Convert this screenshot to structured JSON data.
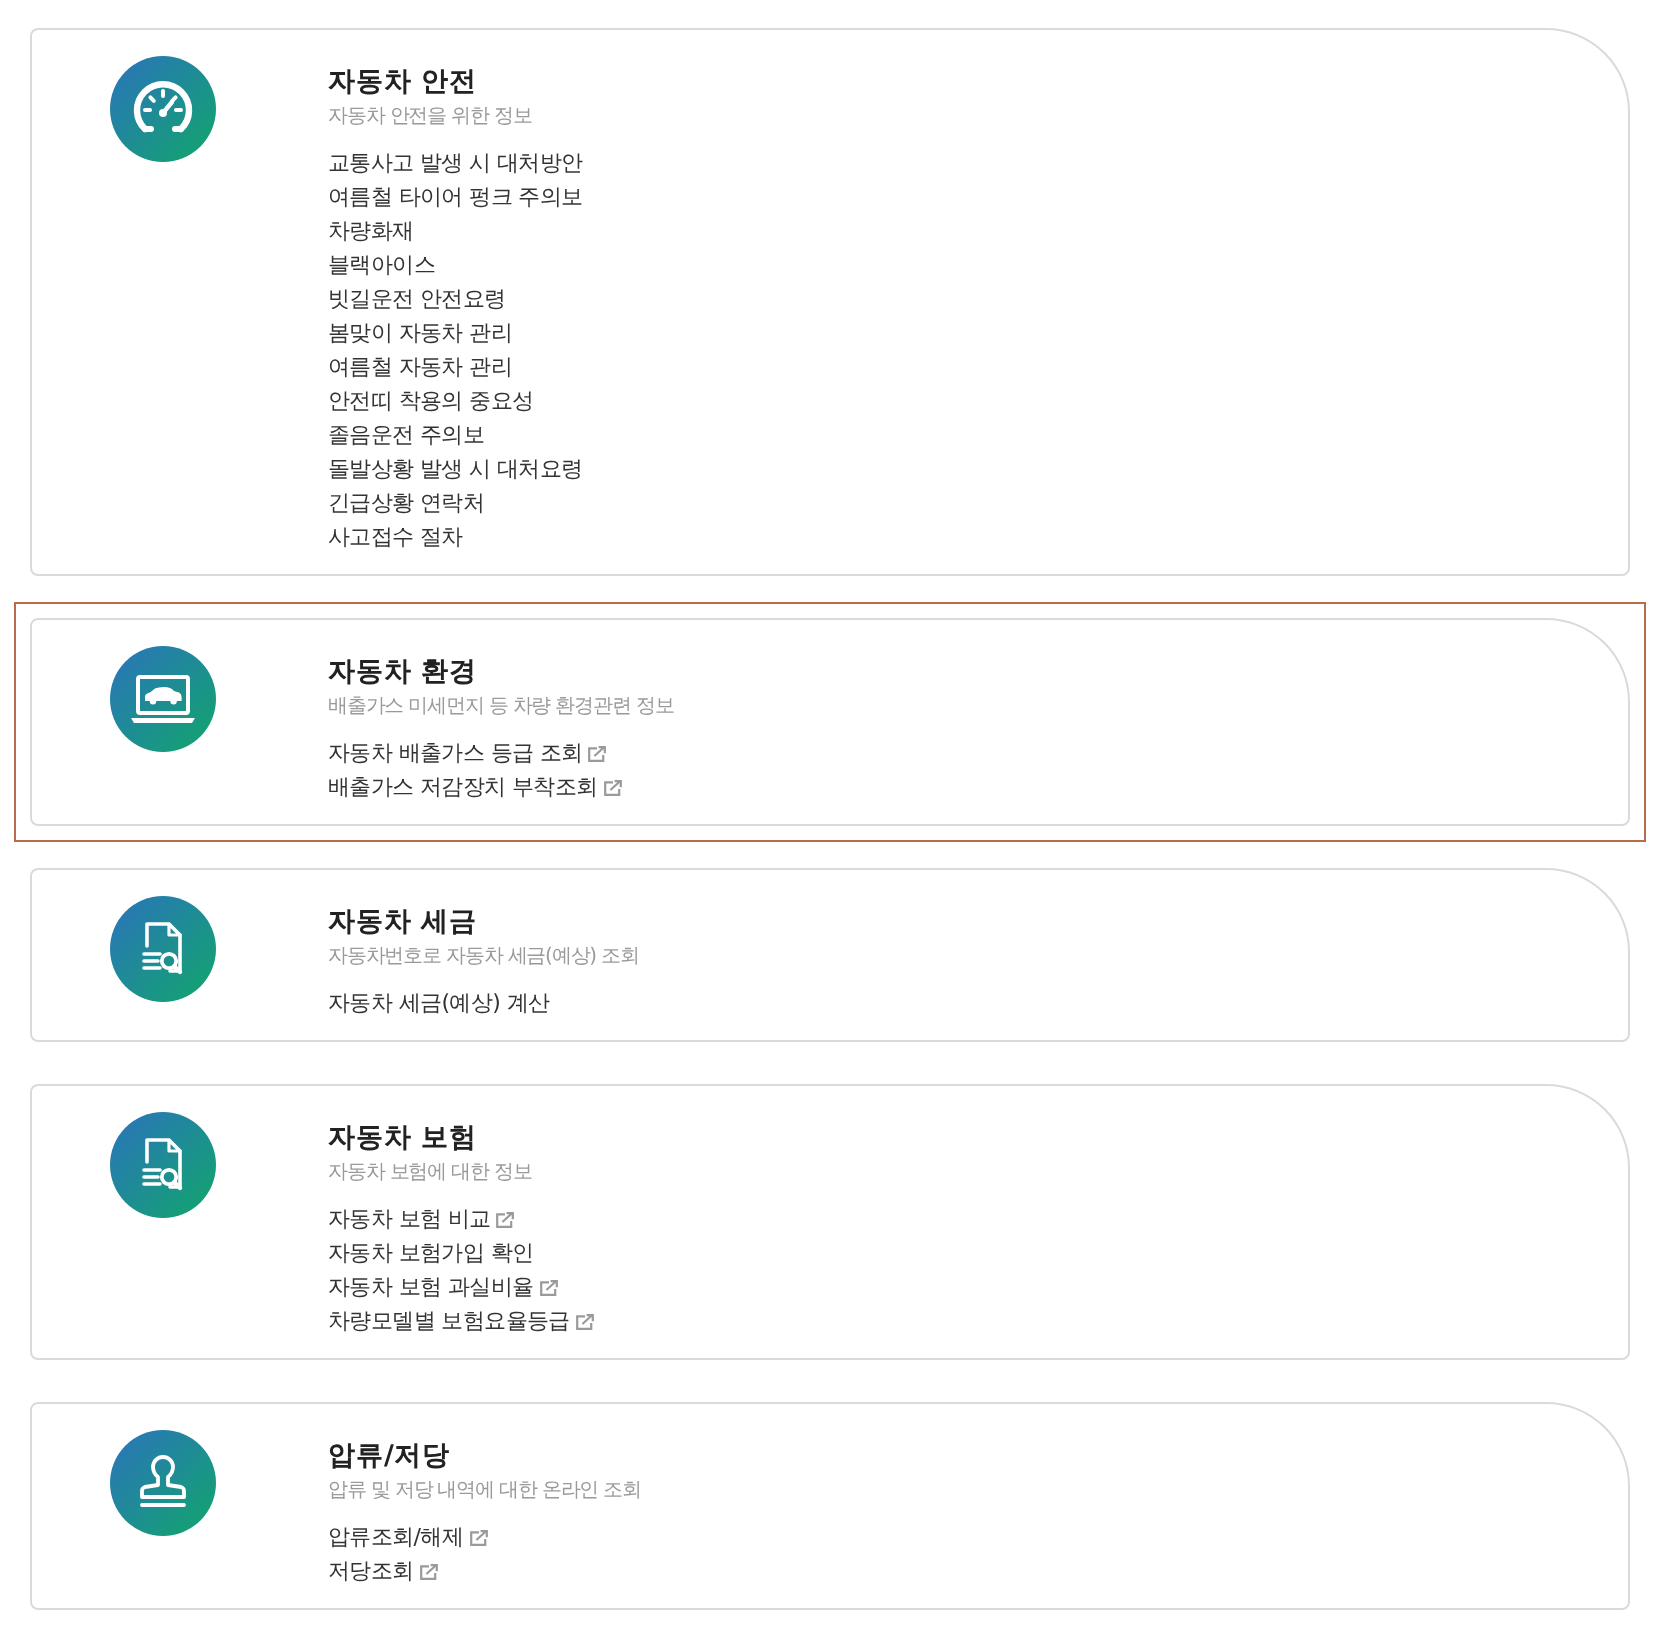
{
  "sections": [
    {
      "kind": "gauge",
      "title": "자동차 안전",
      "subtitle": "자동차 안전을 위한 정보",
      "selected": false,
      "links": [
        {
          "label": "교통사고 발생 시 대처방안",
          "external": false
        },
        {
          "label": "여름철 타이어 펑크 주의보",
          "external": false
        },
        {
          "label": "차량화재",
          "external": false
        },
        {
          "label": "블랙아이스",
          "external": false
        },
        {
          "label": "빗길운전 안전요령",
          "external": false
        },
        {
          "label": "봄맞이 자동차 관리",
          "external": false
        },
        {
          "label": "여름철 자동차 관리",
          "external": false
        },
        {
          "label": "안전띠 착용의 중요성",
          "external": false
        },
        {
          "label": "졸음운전 주의보",
          "external": false
        },
        {
          "label": "돌발상황 발생 시 대처요령",
          "external": false
        },
        {
          "label": "긴급상황 연락처",
          "external": false
        },
        {
          "label": "사고접수 절차",
          "external": false
        }
      ]
    },
    {
      "kind": "laptop-car",
      "title": "자동차 환경",
      "subtitle": "배출가스 미세먼지 등 차량 환경관련 정보",
      "selected": true,
      "links": [
        {
          "label": "자동차 배출가스 등급 조회",
          "external": true
        },
        {
          "label": "배출가스 저감장치 부착조회",
          "external": true
        }
      ]
    },
    {
      "kind": "document-search",
      "title": "자동차 세금",
      "subtitle": "자동차번호로 자동차 세금(예상) 조회",
      "selected": false,
      "links": [
        {
          "label": "자동차 세금(예상) 계산",
          "external": false
        }
      ]
    },
    {
      "kind": "document-search",
      "title": "자동차 보험",
      "subtitle": "자동차 보험에 대한 정보",
      "selected": false,
      "links": [
        {
          "label": "자동차 보험 비교",
          "external": true
        },
        {
          "label": "자동차 보험가입 확인",
          "external": false
        },
        {
          "label": "자동차 보험 과실비율",
          "external": true
        },
        {
          "label": "차량모델별 보험요율등급",
          "external": true
        }
      ]
    },
    {
      "kind": "stamp",
      "title": "압류/저당",
      "subtitle": "압류 및 저당 내역에 대한 온라인 조회",
      "selected": false,
      "links": [
        {
          "label": "압류조회/해제",
          "external": true
        },
        {
          "label": "저당조회",
          "external": true
        }
      ]
    }
  ]
}
